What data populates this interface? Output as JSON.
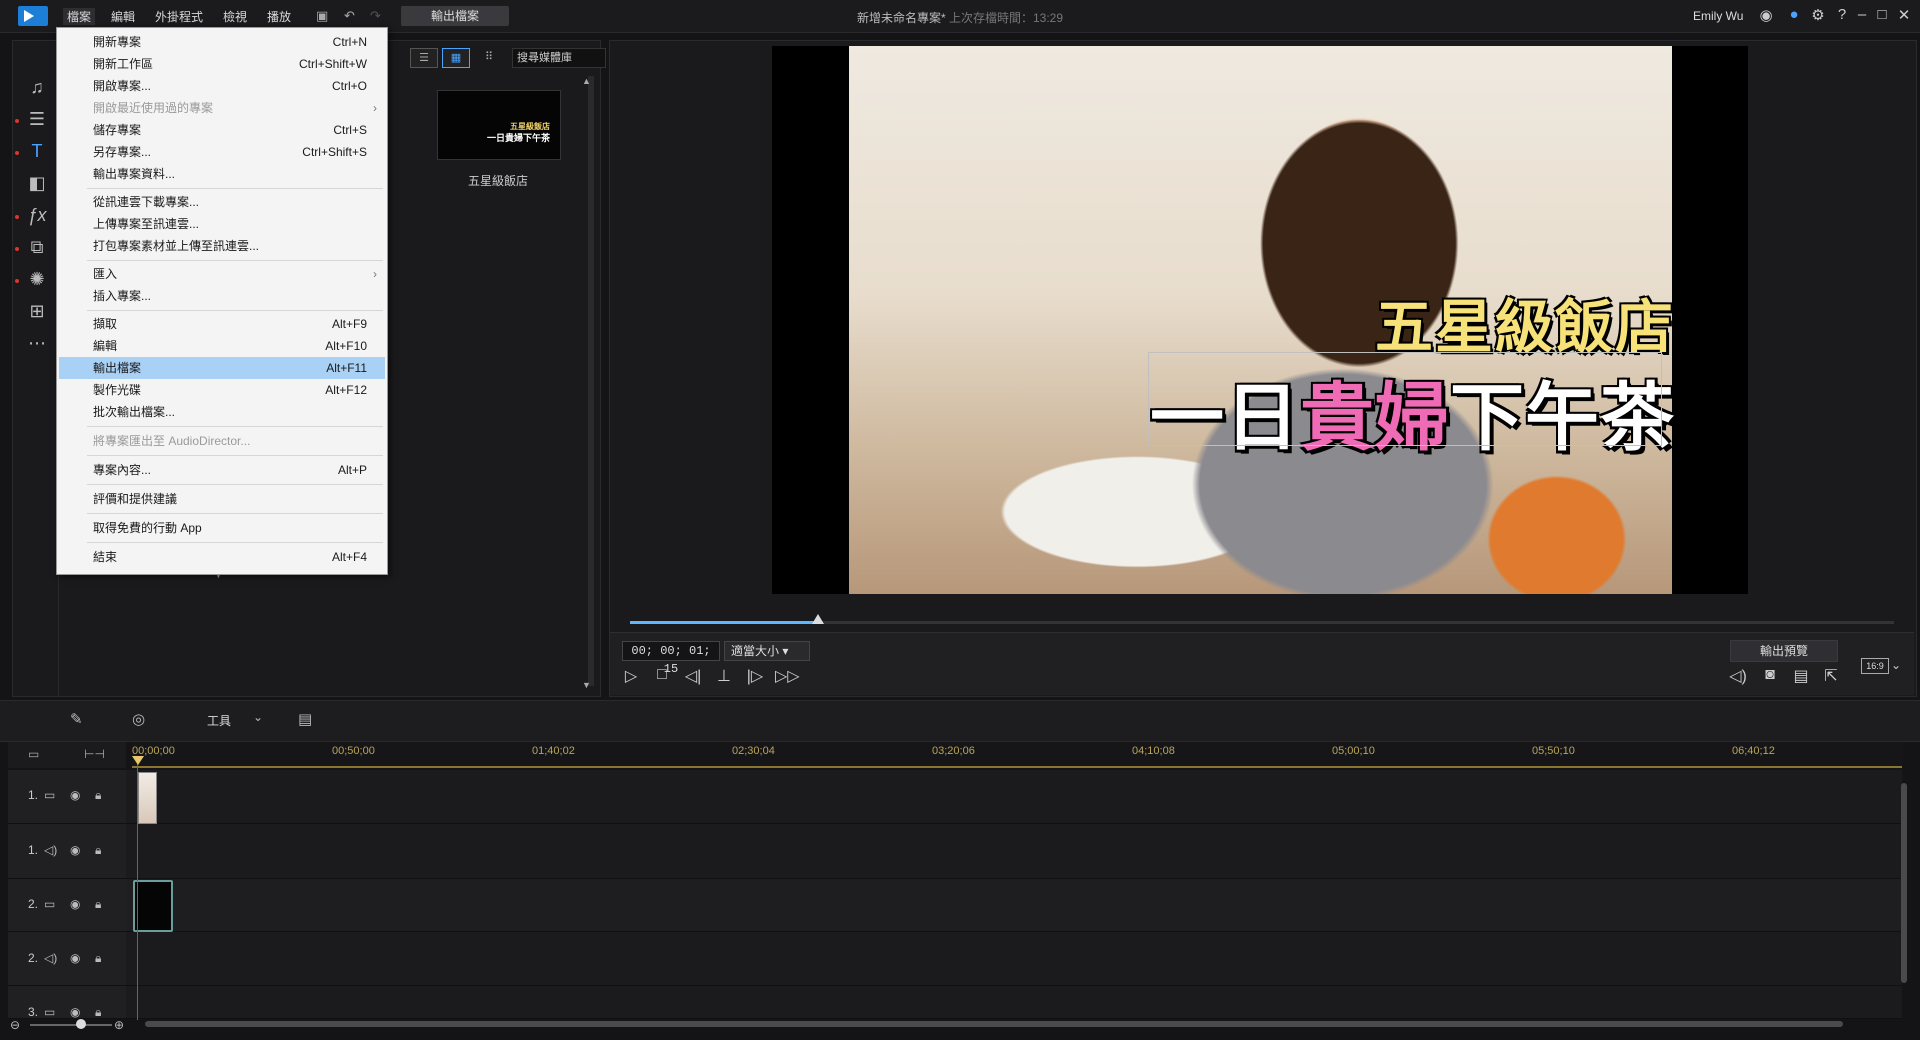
{
  "titlebar": {
    "menus": [
      "檔案",
      "編輯",
      "外掛程式",
      "檢視",
      "播放"
    ],
    "export_label": "輸出檔案",
    "project_title": "新增未命名專案*",
    "last_saved": "上次存檔時間：13:29",
    "user": "Emily Wu"
  },
  "file_menu": {
    "items": [
      {
        "label": "開新專案",
        "shortcut": "Ctrl+N"
      },
      {
        "label": "開新工作區",
        "shortcut": "Ctrl+Shift+W"
      },
      {
        "label": "開啟專案...",
        "shortcut": "Ctrl+O"
      },
      {
        "label": "開啟最近使用過的專案",
        "shortcut": ""
      },
      {
        "label": "儲存專案",
        "shortcut": "Ctrl+S"
      },
      {
        "label": "另存專案...",
        "shortcut": "Ctrl+Shift+S"
      },
      {
        "label": "輸出專案資料...",
        "shortcut": ""
      },
      {
        "label": "從訊連雲下載專案...",
        "shortcut": ""
      },
      {
        "label": "上傳專案至訊連雲...",
        "shortcut": ""
      },
      {
        "label": "打包專案素材並上傳至訊連雲...",
        "shortcut": ""
      },
      {
        "label": "匯入",
        "shortcut": ""
      },
      {
        "label": "插入專案...",
        "shortcut": ""
      },
      {
        "label": "擷取",
        "shortcut": "Alt+F9"
      },
      {
        "label": "編輯",
        "shortcut": "Alt+F10"
      },
      {
        "label": "輸出檔案",
        "shortcut": "Alt+F11"
      },
      {
        "label": "製作光碟",
        "shortcut": "Alt+F12"
      },
      {
        "label": "批次輸出檔案...",
        "shortcut": ""
      },
      {
        "label": "將專案匯出至 AudioDirector...",
        "shortcut": ""
      },
      {
        "label": "專案內容...",
        "shortcut": "Alt+P"
      },
      {
        "label": "評價和提供建議",
        "shortcut": ""
      },
      {
        "label": "取得免費的行動 App",
        "shortcut": ""
      },
      {
        "label": "結束",
        "shortcut": "Alt+F4"
      }
    ]
  },
  "library": {
    "search_placeholder": "搜尋媒體庫",
    "thumb_line1": "五星級飯店",
    "thumb_line2": "一日貴婦下午茶",
    "thumb_label": "五星級飯店"
  },
  "preview": {
    "title_line1": "五星級飯店",
    "title_line2_a": "一日",
    "title_line2_b": "貴婦",
    "title_line2_c": "下午茶",
    "timecode": "00; 00; 01; 15",
    "fit": "適當大小",
    "output_preview": "輸出預覽",
    "aspect": "16:9",
    "seek_fraction": 0.149
  },
  "timeline": {
    "tools_label": "工具",
    "ruler_ticks": [
      "00;00;00",
      "00;50;00",
      "01;40;02",
      "02;30;04",
      "03;20;06",
      "04;10;08",
      "05;00;10",
      "05;50;10",
      "06;40;12"
    ],
    "tracks": [
      "1.",
      "1.",
      "2.",
      "2.",
      "3."
    ]
  },
  "colors": {
    "accent": "#4aa3ff",
    "highlight": "#a9d1f5",
    "title_yellow": "#f7e27a",
    "title_pink": "#f06bb6",
    "playhead": "#dd3333"
  }
}
